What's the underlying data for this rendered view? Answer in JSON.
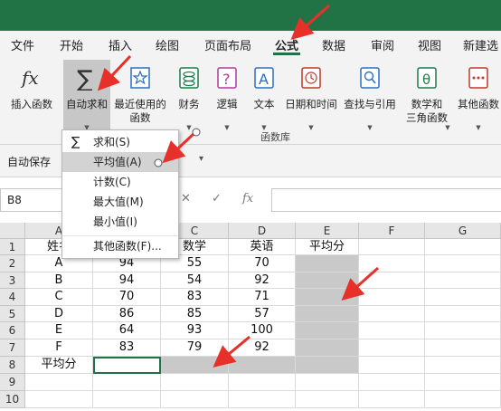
{
  "menu": {
    "items": [
      "文件",
      "开始",
      "插入",
      "绘图",
      "页面布局",
      "公式",
      "数据",
      "审阅",
      "视图",
      "新建选"
    ],
    "active": "公式"
  },
  "ribbon": {
    "insert_function": {
      "label": "插入函数"
    },
    "autosum": {
      "label": "自动求和"
    },
    "recent": {
      "label1": "最近使用的",
      "label2": "函数"
    },
    "finance": {
      "label": "财务"
    },
    "logic": {
      "label": "逻辑"
    },
    "text": {
      "label": "文本"
    },
    "datetime": {
      "label": "日期和时间"
    },
    "lookup": {
      "label": "查找与引用"
    },
    "math": {
      "label1": "数学和",
      "label2": "三角函数"
    },
    "other": {
      "label": "其他函数"
    },
    "group_label": "函数库"
  },
  "qat": {
    "autosave": "自动保存"
  },
  "formula_bar": {
    "cell_ref": "B8",
    "cancel": "✕",
    "confirm": "✓",
    "fx": "fx"
  },
  "autosum_menu": {
    "items": [
      "求和(S)",
      "平均值(A)",
      "计数(C)",
      "最大值(M)",
      "最小值(I)",
      "其他函数(F)..."
    ],
    "highlighted_index": 1
  },
  "sheet": {
    "columns": [
      "A",
      "B",
      "C",
      "D",
      "E",
      "F",
      "G"
    ],
    "rows": [
      "1",
      "2",
      "3",
      "4",
      "5",
      "6",
      "7",
      "8",
      "9",
      "10"
    ],
    "cells": {
      "A1": "姓名",
      "C1": "数学",
      "D1": "英语",
      "E1": "平均分",
      "A2": "A",
      "B2": "94",
      "C2": "55",
      "D2": "70",
      "A3": "B",
      "B3": "94",
      "C3": "54",
      "D3": "92",
      "A4": "C",
      "B4": "70",
      "C4": "83",
      "D4": "71",
      "A5": "D",
      "B5": "86",
      "C5": "85",
      "D5": "57",
      "A6": "E",
      "B6": "64",
      "C6": "93",
      "D6": "100",
      "A7": "F",
      "B7": "83",
      "C7": "79",
      "D7": "92",
      "A8": "平均分"
    },
    "selected_cell": "B8",
    "highlighted_ranges": [
      "E2:E7",
      "C8:E8"
    ]
  },
  "colors": {
    "accent": "#217346",
    "annotation": "#e8302a",
    "highlight": "#c9c9c9"
  }
}
